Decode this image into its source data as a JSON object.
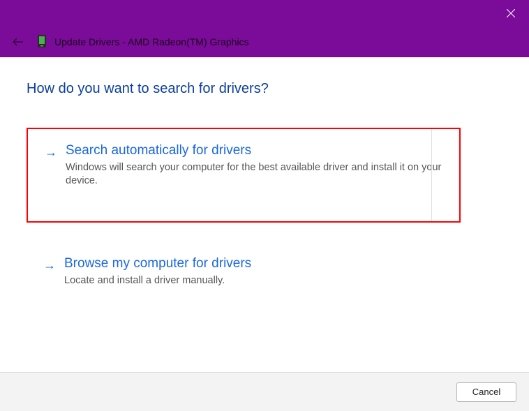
{
  "titlebar": {
    "close_label": "Close"
  },
  "header": {
    "title": "Update Drivers - AMD Radeon(TM) Graphics"
  },
  "content": {
    "heading": "How do you want to search for drivers?",
    "options": [
      {
        "title": "Search automatically for drivers",
        "description": "Windows will search your computer for the best available driver and install it on your device."
      },
      {
        "title": "Browse my computer for drivers",
        "description": "Locate and install a driver manually."
      }
    ]
  },
  "footer": {
    "cancel_label": "Cancel"
  }
}
